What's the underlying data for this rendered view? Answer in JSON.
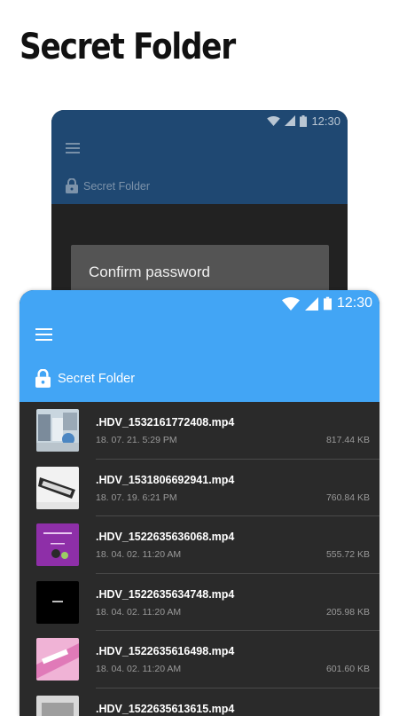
{
  "headline": "Secret Folder",
  "back_screen": {
    "status_time": "12:30",
    "folder_title": "Secret Folder",
    "dialog_title": "Confirm password"
  },
  "front_screen": {
    "status_time": "12:30",
    "folder_title": "Secret Folder",
    "files": [
      {
        "name": ".HDV_1532161772408.mp4",
        "date": "18. 07. 21. 5:29 PM",
        "size": "817.44 KB"
      },
      {
        "name": ".HDV_1531806692941.mp4",
        "date": "18. 07. 19. 6:21 PM",
        "size": "760.84 KB"
      },
      {
        "name": ".HDV_1522635636068.mp4",
        "date": "18. 04. 02. 11:20 AM",
        "size": "555.72 KB"
      },
      {
        "name": ".HDV_1522635634748.mp4",
        "date": "18. 04. 02. 11:20 AM",
        "size": "205.98 KB"
      },
      {
        "name": ".HDV_1522635616498.mp4",
        "date": "18. 04. 02. 11:20 AM",
        "size": "601.60 KB"
      },
      {
        "name": ".HDV_1522635613615.mp4",
        "date": "",
        "size": ""
      }
    ]
  },
  "colors": {
    "accent": "#42a5f5",
    "back_appbar": "#1f4872",
    "list_bg": "#2a2a2a"
  }
}
